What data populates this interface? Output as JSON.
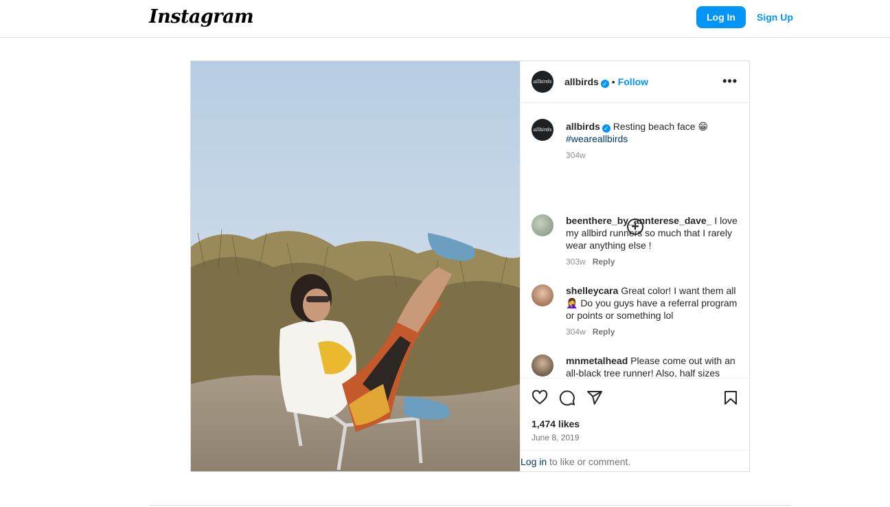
{
  "header": {
    "logo_text": "Instagram",
    "login_label": "Log In",
    "signup_label": "Sign Up"
  },
  "post": {
    "author": {
      "username": "allbirds",
      "avatar_text": "allbirds",
      "verified": true
    },
    "follow_label": "Follow",
    "separator": "•",
    "caption": {
      "username": "allbirds",
      "text": "Resting beach face 😁",
      "hashtag": "#weareallbirds",
      "age": "304w"
    },
    "comments": [
      {
        "username": "beenthere_by_annterese_dave_",
        "text": "I love my allbird runners so much that I rarely wear anything else !",
        "age": "303w",
        "reply_label": "Reply"
      },
      {
        "username": "shelleycara",
        "text": "Great color! I want them all 🤦‍♀️ Do you guys have a referral program or points or something lol",
        "age": "304w",
        "reply_label": "Reply"
      },
      {
        "username": "mnmetalhead",
        "text": "Please come out with an all-black tree runner! Also, half sizes",
        "age": "",
        "reply_label": ""
      }
    ],
    "likes": "1,474 likes",
    "date": "June 8, 2019",
    "login_prompt": {
      "link": "Log in",
      "rest": " to like or comment."
    }
  },
  "colors": {
    "accent": "#0095f6",
    "hashtag": "#00376b",
    "border": "#dbdbdb",
    "muted": "#737373"
  },
  "icons": [
    "more-options-icon",
    "load-more-comments-icon",
    "heart-icon",
    "comment-icon",
    "share-icon",
    "bookmark-icon",
    "verified-badge-icon"
  ]
}
